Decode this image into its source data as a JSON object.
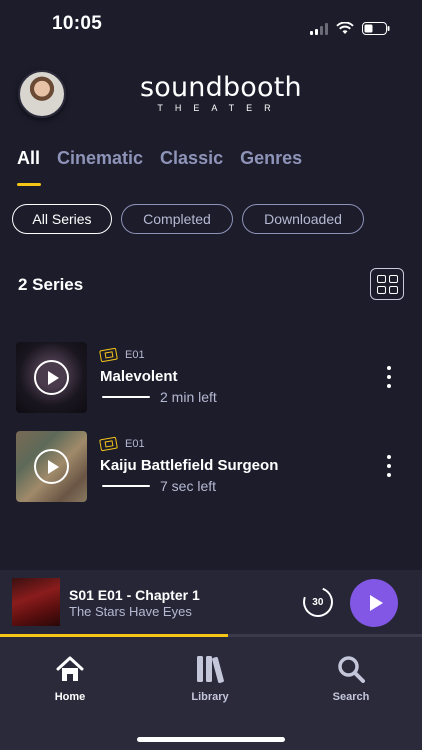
{
  "status_bar": {
    "time": "10:05"
  },
  "header": {
    "logo_main": "soundbooth",
    "logo_sub": "THEATER"
  },
  "category_tabs": [
    {
      "label": "All",
      "active": true
    },
    {
      "label": "Cinematic",
      "active": false
    },
    {
      "label": "Classic",
      "active": false
    },
    {
      "label": "Genres",
      "active": false
    }
  ],
  "filter_chips": [
    {
      "label": "All Series",
      "active": true
    },
    {
      "label": "Completed",
      "active": false
    },
    {
      "label": "Downloaded",
      "active": false
    }
  ],
  "series_count": "2 Series",
  "series": [
    {
      "episode": "E01",
      "title": "Malevolent",
      "time_left": "2 min left"
    },
    {
      "episode": "E01",
      "title": "Kaiju Battlefield Surgeon",
      "time_left": "7 sec left"
    }
  ],
  "mini_player": {
    "title": "S01 E01 - Chapter 1",
    "subtitle": "The Stars Have Eyes",
    "rewind_label": "30",
    "progress": 0.54
  },
  "bottom_nav": [
    {
      "label": "Home",
      "icon": "home-icon",
      "active": true
    },
    {
      "label": "Library",
      "icon": "library-icon",
      "active": false
    },
    {
      "label": "Search",
      "icon": "search-icon",
      "active": false
    }
  ],
  "colors": {
    "accent": "#f5c518",
    "play": "#8257e5",
    "background": "#1c1c2b"
  }
}
